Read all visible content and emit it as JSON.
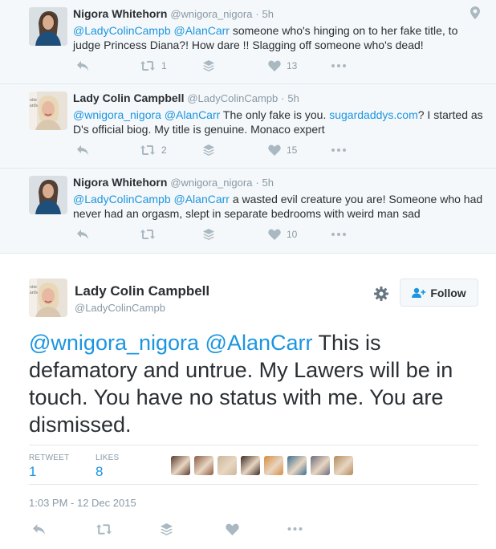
{
  "thread": [
    {
      "name": "Nigora Whitehorn",
      "handle": "@wnigora_nigora",
      "dot": "·",
      "time": "5h",
      "mentions": "@LadyColinCampb @AlanCarr",
      "text": " someone who's hinging on to her fake title, to judge Princess Diana?! How dare !! Slagging off someone who's dead!",
      "retweets": "1",
      "likes": "13",
      "avatar": "avatar-nigora",
      "show_geo": true
    },
    {
      "name": "Lady Colin Campbell",
      "handle": "@LadyColinCampb",
      "dot": "·",
      "time": "5h",
      "mentions": "@wnigora_nigora @AlanCarr",
      "text_before_link": " The only fake is you. ",
      "link": "sugardaddys.com",
      "text_after_link": "? I started as D's official biog. My title is genuine. Monaco expert",
      "retweets": "2",
      "likes": "15",
      "avatar": "avatar-lady-colin"
    },
    {
      "name": "Nigora Whitehorn",
      "handle": "@wnigora_nigora",
      "dot": "·",
      "time": "5h",
      "mentions": "@LadyColinCampb @AlanCarr",
      "text": " a wasted evil creature you are! Someone who had never had an orgasm, slept in separate bedrooms with weird man sad",
      "retweets": "",
      "likes": "10",
      "avatar": "avatar-nigora"
    }
  ],
  "main": {
    "name": "Lady Colin Campbell",
    "handle": "@LadyColinCampb",
    "follow_label": "Follow",
    "mentions": "@wnigora_nigora @AlanCarr",
    "text": " This is defamatory and untrue. My Lawers will be in touch. You have no status with me. You are dismissed.",
    "retweet_label": "RETWEET",
    "retweet_count": "1",
    "likes_label": "LIKES",
    "likes_count": "8",
    "date": "1:03 PM - 12 Dec 2015",
    "likers": [
      "#5a3a2e",
      "#8a5a44",
      "#c9b79c",
      "#3b2a22",
      "#d88a3c",
      "#3c6e8f",
      "#6b6b7b",
      "#b08a5a"
    ]
  },
  "colors": {
    "link": "#1b95e0",
    "text": "#292f33",
    "muted": "#8899a6",
    "thread_bg": "#f5f8fa",
    "border": "#e1e8ed"
  },
  "icons": {
    "reply": "reply-icon",
    "retweet": "retweet-icon",
    "buffer": "buffer-stack-icon",
    "like": "heart-icon",
    "more": "more-dots-icon",
    "geo": "location-pin-icon",
    "gear": "gear-icon",
    "follow": "add-user-icon"
  }
}
